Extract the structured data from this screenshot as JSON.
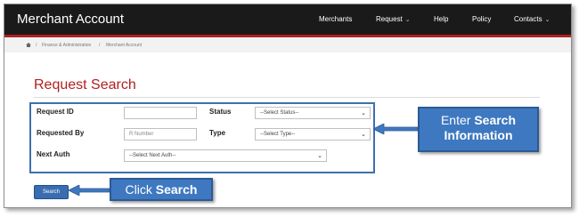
{
  "app": {
    "title": "Merchant Account"
  },
  "nav": {
    "merchants": "Merchants",
    "request": "Request",
    "help": "Help",
    "policy": "Policy",
    "contacts": "Contacts"
  },
  "breadcrumb": {
    "sep1": "/",
    "item1": "Finance & Administration",
    "sep2": "/",
    "item2": "Merchant Account"
  },
  "page": {
    "title": "Request Search"
  },
  "form": {
    "request_id_label": "Request ID",
    "requested_by_label": "Requested By",
    "requested_by_placeholder": "R Number",
    "next_auth_label": "Next Auth",
    "next_auth_value": "--Select Next Auth--",
    "status_label": "Status",
    "status_value": "--Select Status--",
    "type_label": "Type",
    "type_value": "--Select Type--",
    "search_label": "Search"
  },
  "callouts": {
    "enter_prefix": "Enter",
    "enter_bold1": "Search",
    "enter_bold2": "Information",
    "click_prefix": "Click",
    "click_bold": "Search"
  },
  "colors": {
    "accent_red": "#b21f1f",
    "navbar": "#1a1a1a",
    "callout_blue": "#3e78c0",
    "button_blue": "#3a6cb0"
  }
}
